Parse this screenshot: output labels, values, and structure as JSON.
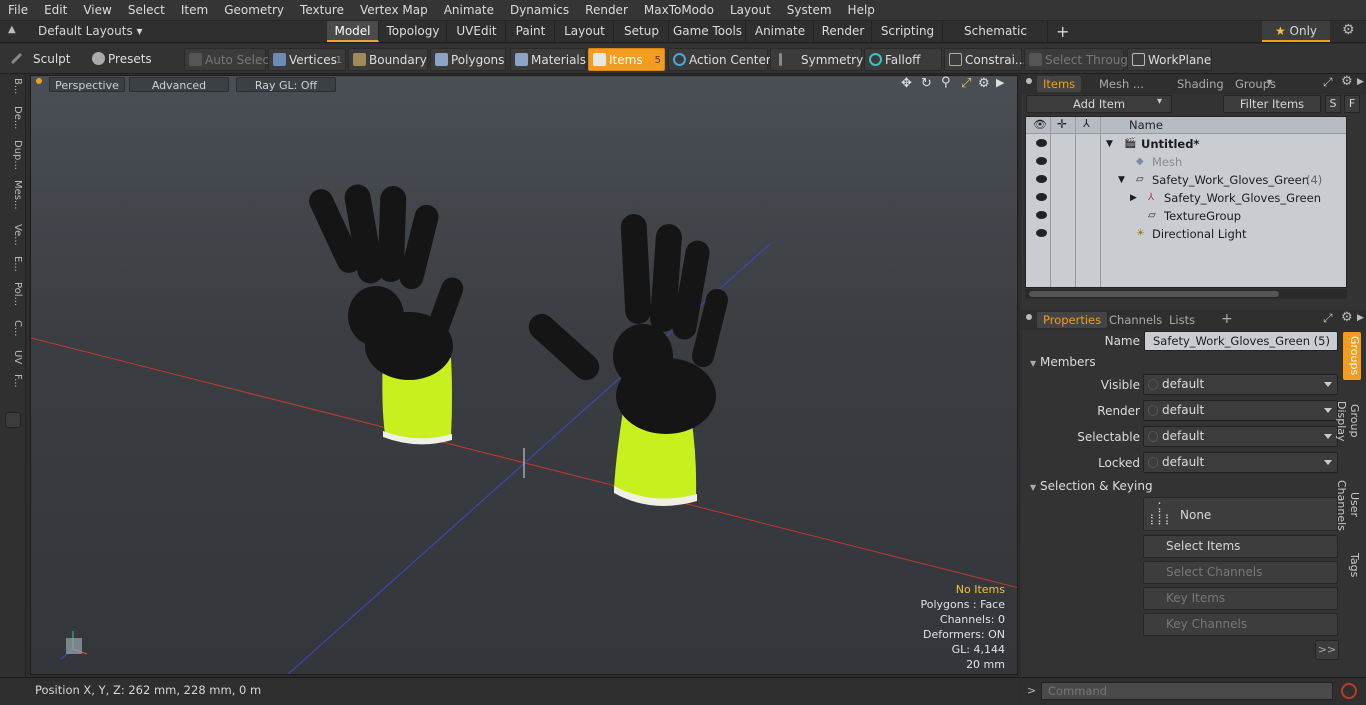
{
  "menubar": {
    "items": [
      "File",
      "Edit",
      "View",
      "Select",
      "Item",
      "Geometry",
      "Texture",
      "Vertex Map",
      "Animate",
      "Dynamics",
      "Render",
      "MaxToModo",
      "Layout",
      "System",
      "Help"
    ]
  },
  "layoutbar": {
    "layouts_label": "Default Layouts",
    "tabs": [
      "Model",
      "Topology",
      "UVEdit",
      "Paint",
      "Layout",
      "Setup",
      "Game Tools",
      "Animate",
      "Render",
      "Scripting",
      "Schematic Fusion"
    ],
    "active_tab": "Model",
    "add_label": "+",
    "only_label": "Only"
  },
  "toolbar": {
    "sculpt": "Sculpt",
    "presets": "Presets",
    "auto_select": "Auto Select",
    "vertices": "Vertices",
    "vertices_count": "1",
    "boundary": "Boundary",
    "polygons": "Polygons",
    "materials": "Materials",
    "items": "Items",
    "items_count": "5",
    "action_center": "Action Center",
    "symmetry": "Symmetry",
    "falloff": "Falloff",
    "constraints": "Constrai...",
    "select_through": "Select Through",
    "workplane": "WorkPlane"
  },
  "lefttabs": [
    "B...",
    "De...",
    "Dup...",
    "Mes...",
    "Ve...",
    "E...",
    "Pol...",
    "C...",
    "UV",
    "F..."
  ],
  "viewport": {
    "perspective": "Perspective",
    "advanced": "Advanced",
    "raygl": "Ray GL: Off",
    "hud": {
      "no_items": "No Items",
      "polygons": "Polygons : Face",
      "channels": "Channels: 0",
      "deformers": "Deformers: ON",
      "gl": "GL: 4,144",
      "scale": "20 mm"
    }
  },
  "statusbar": {
    "position": "Position X, Y, Z:   262 mm, 228 mm, 0 m"
  },
  "items_panel": {
    "tabs": [
      "Items",
      "Mesh ...",
      "Shading",
      "Groups"
    ],
    "add_item": "Add Item",
    "filter_items": "Filter Items",
    "s_btn": "S",
    "f_btn": "F",
    "name_header": "Name",
    "rows": [
      {
        "label": "Untitled*"
      },
      {
        "label": "Mesh"
      },
      {
        "label": "Safety_Work_Gloves_Green",
        "count": "(4)"
      },
      {
        "label": "Safety_Work_Gloves_Green"
      },
      {
        "label": "TextureGroup"
      },
      {
        "label": "Directional Light"
      }
    ]
  },
  "properties_panel": {
    "tabs": [
      "Properties",
      "Channels",
      "Lists"
    ],
    "add_label": "+",
    "name_label": "Name",
    "name_value": "Safety_Work_Gloves_Green (5)",
    "members": "Members",
    "visible_label": "Visible",
    "visible_value": "default",
    "render_label": "Render",
    "render_value": "default",
    "selectable_label": "Selectable",
    "selectable_value": "default",
    "locked_label": "Locked",
    "locked_value": "default",
    "selection_keying": "Selection & Keying",
    "none_label": "None",
    "select_items": "Select Items",
    "select_channels": "Select Channels",
    "key_items": "Key Items",
    "key_channels": "Key Channels",
    "more": ">>",
    "side_tabs": [
      "Groups",
      "Group Display",
      "User Channels",
      "Tags"
    ]
  },
  "command": {
    "placeholder": "Command",
    "prompt": ">"
  },
  "colors": {
    "accent": "#f39c1f",
    "x_axis": "#c0392b",
    "z_axis": "#3a49c8",
    "glove_black": "#151515",
    "glove_cuff": "#c8f01e"
  }
}
